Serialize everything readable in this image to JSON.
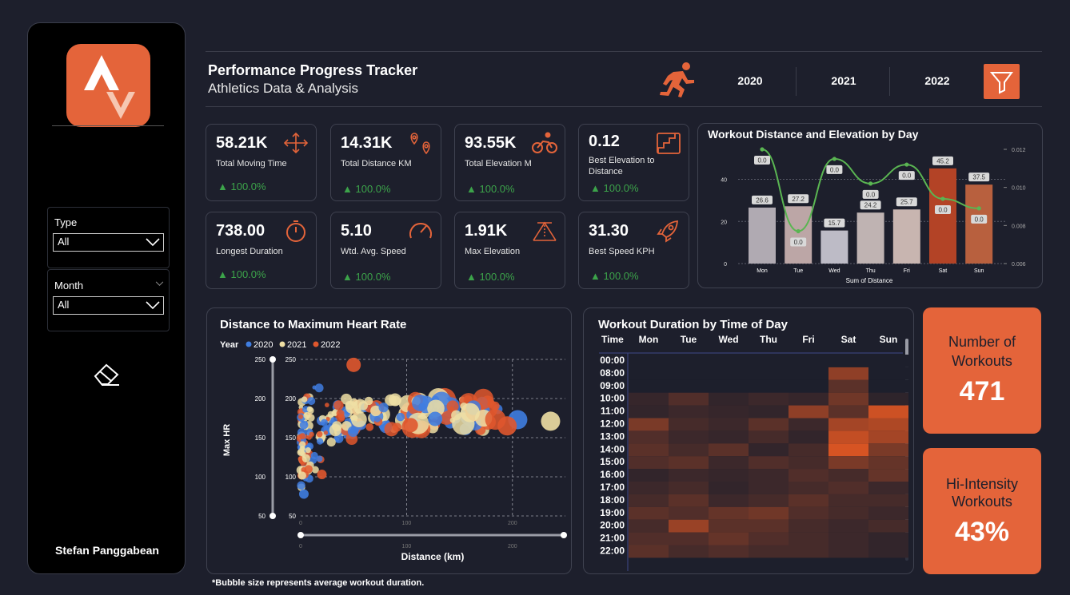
{
  "sidebar": {
    "author": "Stefan Panggabean",
    "slicers": [
      {
        "label": "Type",
        "value": "All"
      },
      {
        "label": "Month",
        "value": "All"
      }
    ]
  },
  "header": {
    "title": "Performance Progress Tracker",
    "subtitle": "Athletics Data & Analysis",
    "years": [
      "2020",
      "2021",
      "2022"
    ],
    "accent": "#e4643a"
  },
  "cards": [
    {
      "value": "58.21K",
      "label": "Total Moving Time",
      "pct": "100.0%",
      "icon": "move-arrows-icon"
    },
    {
      "value": "14.31K",
      "label": "Total Distance KM",
      "pct": "100.0%",
      "icon": "location-pins-icon"
    },
    {
      "value": "93.55K",
      "label": "Total Elevation M",
      "pct": "100.0%",
      "icon": "cyclist-icon"
    },
    {
      "value": "0.12",
      "label": "Best Elevation to Distance",
      "pct": "100.0%",
      "icon": "stairs-icon"
    },
    {
      "value": "738.00",
      "label": "Longest Duration",
      "pct": "100.0%",
      "icon": "stopwatch-icon"
    },
    {
      "value": "5.10",
      "label": "Wtd. Avg. Speed",
      "pct": "100.0%",
      "icon": "speedometer-icon"
    },
    {
      "value": "1.91K",
      "label": "Max Elevation",
      "pct": "100.0%",
      "icon": "elevation-icon"
    },
    {
      "value": "31.30",
      "label": "Best Speed KPH",
      "pct": "100.0%",
      "icon": "rocket-icon"
    }
  ],
  "kpis": {
    "workouts_title": "Number of Workouts",
    "workouts_value": "471",
    "hi_title": "Hi-Intensity Workouts",
    "hi_value": "43%"
  },
  "footnote": "*Bubble size represents average workout duration.",
  "chart_data": [
    {
      "type": "bar",
      "title": "Workout Distance and Elevation by Day",
      "xlabel": "Sum of Distance",
      "categories": [
        "Mon",
        "Tue",
        "Wed",
        "Thu",
        "Fri",
        "Sat",
        "Sun"
      ],
      "series": [
        {
          "values": [
            26.6,
            27.2,
            15.7,
            24.2,
            25.7,
            45.2,
            37.5
          ],
          "colors": [
            "#b0aab2",
            "#bca6a6",
            "#bdbbc6",
            "#bfb3b2",
            "#c8b5b0",
            "#b34326",
            "#b8603e"
          ]
        },
        {
          "values": [
            0.0,
            0.0,
            0.0,
            0.0,
            0.0,
            0.0,
            0.0
          ],
          "line_level": [
            0.012,
            0.0077,
            0.0115,
            0.0102,
            0.0112,
            0.0094,
            0.0089
          ],
          "color": "#5ab552"
        }
      ],
      "y_ticks": [
        "0",
        "20",
        "40"
      ],
      "y2_ticks": [
        "0.006",
        "0.008",
        "0.010",
        "0.012"
      ],
      "ylim": [
        0,
        55
      ]
    },
    {
      "type": "scatter",
      "title": "Distance to Maximum Heart Rate",
      "legend_title": "Year",
      "legend": [
        {
          "name": "2020",
          "color": "#3f7de0"
        },
        {
          "name": "2021",
          "color": "#efdfa4"
        },
        {
          "name": "2022",
          "color": "#e0572d"
        }
      ],
      "xlabel": "Distance (km)",
      "ylabel": "Max HR",
      "x_ticks": [
        "0",
        "100",
        "200"
      ],
      "y_ticks": [
        "50",
        "100",
        "150",
        "200",
        "250"
      ],
      "xlim": [
        0,
        250
      ],
      "ylim": [
        50,
        250
      ],
      "notable_points": [
        {
          "x": 50,
          "y": 243,
          "series": "2022"
        },
        {
          "x": 236,
          "y": 171,
          "series": "2021"
        },
        {
          "x": 205,
          "y": 173,
          "series": "2020"
        },
        {
          "x": 195,
          "y": 165,
          "series": "2022"
        },
        {
          "x": 160,
          "y": 182,
          "series": "2021"
        },
        {
          "x": 127,
          "y": 174,
          "series": "2020"
        },
        {
          "x": 104,
          "y": 166,
          "series": "2022"
        },
        {
          "x": 20,
          "y": 103,
          "series": "2022"
        },
        {
          "x": 3,
          "y": 78,
          "series": "2020"
        }
      ]
    },
    {
      "type": "heatmap",
      "title": "Workout Duration by Time of Day",
      "row_header": "Time",
      "columns": [
        "Mon",
        "Tue",
        "Wed",
        "Thu",
        "Fri",
        "Sat",
        "Sun"
      ],
      "rows": [
        "00:00",
        "08:00",
        "09:00",
        "10:00",
        "11:00",
        "12:00",
        "13:00",
        "14:00",
        "15:00",
        "16:00",
        "17:00",
        "18:00",
        "19:00",
        "20:00",
        "21:00",
        "22:00"
      ],
      "values": [
        [
          0,
          0,
          0,
          0,
          0,
          0,
          0
        ],
        [
          0,
          0,
          0,
          0,
          0,
          0.55,
          0
        ],
        [
          0,
          0,
          0,
          0,
          0,
          0.3,
          0
        ],
        [
          0.12,
          0.25,
          0.1,
          0.15,
          0.12,
          0.4,
          0.08
        ],
        [
          0.1,
          0.15,
          0.12,
          0.1,
          0.55,
          0.3,
          0.85
        ],
        [
          0.45,
          0.2,
          0.15,
          0.3,
          0.15,
          0.65,
          0.7
        ],
        [
          0.25,
          0.15,
          0.12,
          0.2,
          0.1,
          0.8,
          0.65
        ],
        [
          0.3,
          0.2,
          0.3,
          0.1,
          0.2,
          0.9,
          0.45
        ],
        [
          0.25,
          0.3,
          0.15,
          0.25,
          0.2,
          0.45,
          0.35
        ],
        [
          0.1,
          0.15,
          0.12,
          0.15,
          0.25,
          0.2,
          0.35
        ],
        [
          0.15,
          0.2,
          0.1,
          0.15,
          0.2,
          0.25,
          0.15
        ],
        [
          0.2,
          0.3,
          0.15,
          0.2,
          0.3,
          0.2,
          0.2
        ],
        [
          0.3,
          0.25,
          0.35,
          0.4,
          0.25,
          0.2,
          0.15
        ],
        [
          0.2,
          0.6,
          0.3,
          0.3,
          0.2,
          0.15,
          0.2
        ],
        [
          0.25,
          0.25,
          0.35,
          0.25,
          0.2,
          0.15,
          0.1
        ],
        [
          0.3,
          0.2,
          0.25,
          0.2,
          0.2,
          0.15,
          0.1
        ]
      ],
      "color_low": "#1d1f2c",
      "color_high": "#ec5a22"
    }
  ]
}
